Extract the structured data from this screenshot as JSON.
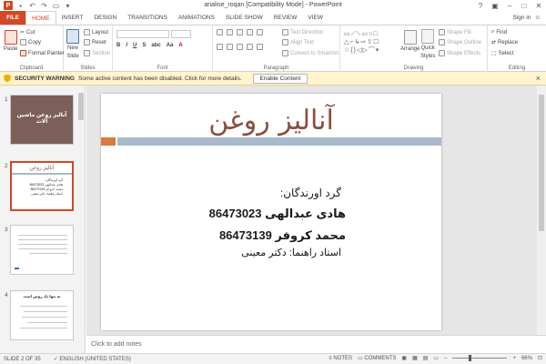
{
  "window": {
    "title": "analise_roqan [Compatibility Mode] - PowerPoint",
    "app_letter": "P",
    "controls": [
      "?",
      "▣",
      "–",
      "□",
      "✕"
    ]
  },
  "ribbon_tabs": [
    "FILE",
    "HOME",
    "INSERT",
    "DESIGN",
    "TRANSITIONS",
    "ANIMATIONS",
    "SLIDE SHOW",
    "REVIEW",
    "VIEW"
  ],
  "signin": "Sign in",
  "clipboard": {
    "paste": "Paste",
    "cut": "Cut",
    "copy": "Copy",
    "format_painter": "Format Painter",
    "label": "Clipboard"
  },
  "slides_group": {
    "new_slide": "New",
    "new_slide2": "Slide",
    "layout": "Layout",
    "reset": "Reset",
    "section": "Section",
    "label": "Slides"
  },
  "font_group": {
    "label": "Font",
    "bold": "B",
    "italic": "I",
    "underline": "U",
    "strike": "S",
    "shadow": "abc",
    "aa": "Aa",
    "A": "A"
  },
  "paragraph_group": {
    "text_direction": "Text Direction",
    "align_text": "Align Text",
    "smartart": "Convert to SmartArt",
    "label": "Paragraph"
  },
  "drawing_group": {
    "arrange": "Arrange",
    "quick": "Quick",
    "styles": "Styles",
    "shape_fill": "Shape Fill",
    "shape_outline": "Shape Outline",
    "shape_effects": "Shape Effects",
    "label": "Drawing"
  },
  "editing_group": {
    "find": "Find",
    "replace": "Replace",
    "select": "Select",
    "label": "Editing"
  },
  "security": {
    "title": "SECURITY WARNING",
    "message": "Some active content has been disabled. Click for more details.",
    "button": "Enable Content"
  },
  "thumbnails": [
    {
      "num": "1",
      "title": "آنالیز روغن ماشین آلات"
    },
    {
      "num": "2",
      "title": "آنالیز روغن",
      "l1": "گرد آورندگان:",
      "l2": "هادی عبدالهی 86473023",
      "l3": "محمد کرو فر 86473139",
      "l4": "استاد راهنما: دکتر معینی"
    },
    {
      "num": "3"
    },
    {
      "num": "4",
      "title": "نه تنها یک روش است"
    }
  ],
  "slide": {
    "title": "آنالیز روغن",
    "line1": "گرد اورندگان:",
    "line2": "هادی عبدالهی 86473023",
    "line3": "محمد کروفر 86473139",
    "line4": "استاد راهنما: دکتر معینی"
  },
  "notes_placeholder": "Click to add notes",
  "status": {
    "slide": "SLIDE 2 OF 35",
    "language": "ENGLISH (UNITED STATES)",
    "notes": "NOTES",
    "comments": "COMMENTS",
    "zoom": "66%",
    "zoom_level": 0.66
  }
}
